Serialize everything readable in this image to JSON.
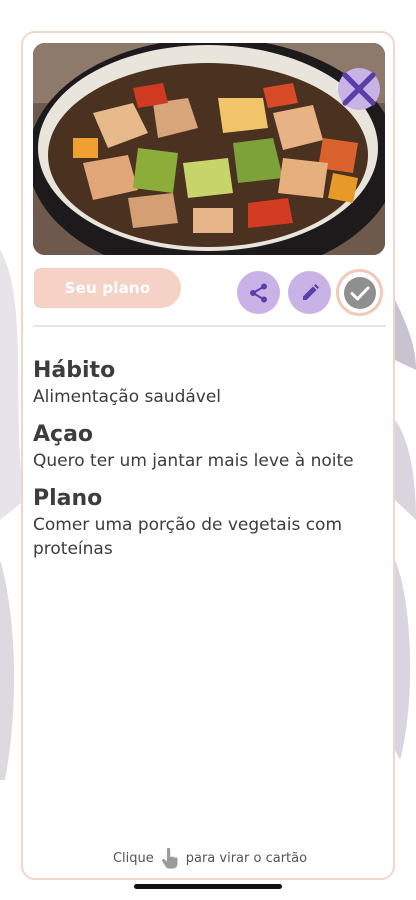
{
  "card": {
    "tab_label": "Seu plano",
    "sections": [
      {
        "title": "Hábito",
        "text": "Alimentação saudável"
      },
      {
        "title": "Açao",
        "text": "Quero ter um jantar mais leve à noite"
      },
      {
        "title": "Plano",
        "text": "Comer uma porção de vegetais com proteínas"
      }
    ],
    "footer_before": "Clique",
    "footer_after": "para virar o cartão"
  },
  "colors": {
    "accent_purple": "#c9b3e6",
    "icon_purple": "#5b3fa8",
    "tab_peach": "#f5d2c5",
    "border_peach": "#f2d6c9"
  },
  "icons": {
    "close": "close-icon",
    "share": "share-icon",
    "edit": "pencil-icon",
    "check": "check-icon",
    "tap": "tap-hand-icon"
  }
}
